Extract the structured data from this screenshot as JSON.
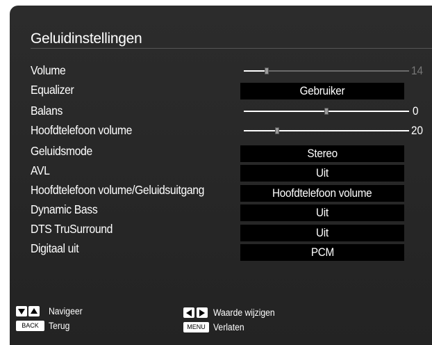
{
  "title": "Geluidinstellingen",
  "settings": {
    "volume": {
      "label": "Volume",
      "value": "14",
      "level": 0.14
    },
    "equalizer": {
      "label": "Equalizer",
      "value": "Gebruiker"
    },
    "balance": {
      "label": "Balans",
      "value": "0",
      "level": 0.5
    },
    "headphone_volume": {
      "label": "Hoofdtelefoon volume",
      "value": "20",
      "level": 0.2
    },
    "sound_mode": {
      "label": "Geluidsmode",
      "value": "Stereo"
    },
    "avl": {
      "label": "AVL",
      "value": "Uit"
    },
    "headphone_output": {
      "label": "Hoofdtelefoon volume/Geluidsuitgang",
      "value": "Hoofdtelefoon volume"
    },
    "dynamic_bass": {
      "label": "Dynamic Bass",
      "value": "Uit"
    },
    "dts": {
      "label": "DTS TruSurround",
      "value": "Uit"
    },
    "digital_out": {
      "label": "Digitaal uit",
      "value": "PCM"
    }
  },
  "footer": {
    "navigate": "Navigeer",
    "change_value": "Waarde wijzigen",
    "back_key": "BACK",
    "back": "Terug",
    "menu_key": "MENU",
    "exit": "Verlaten"
  }
}
